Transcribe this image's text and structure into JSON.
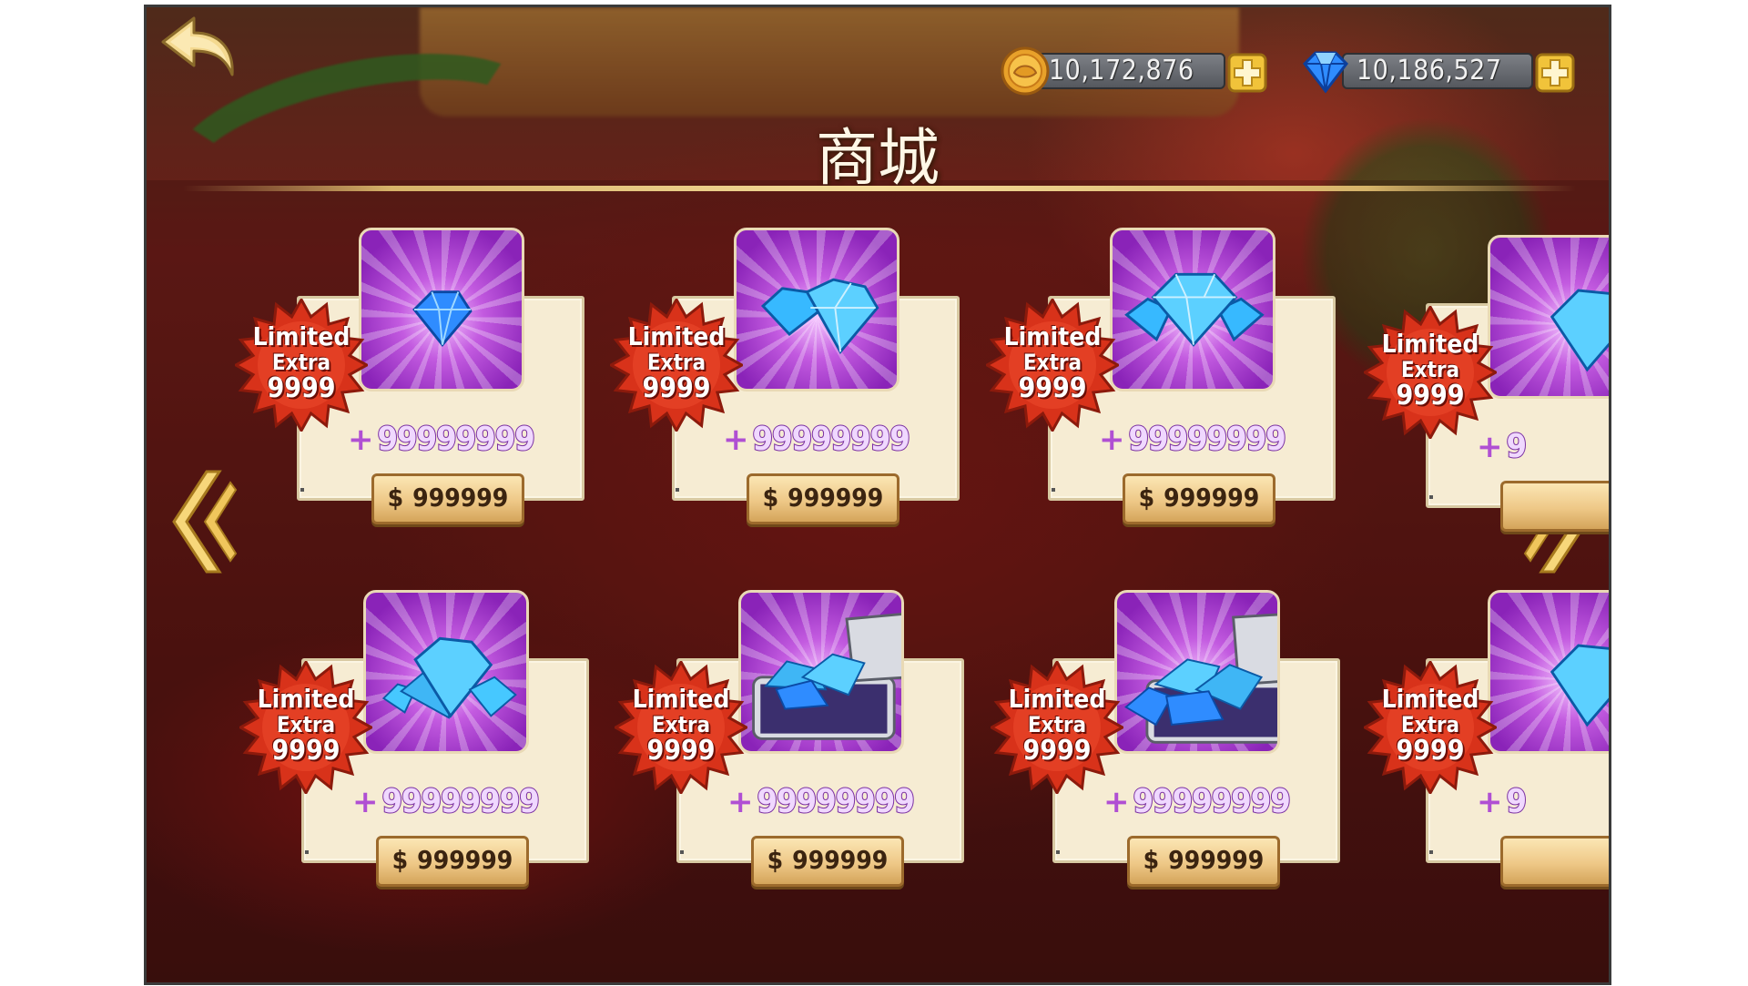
{
  "header": {
    "title": "商城",
    "coins": "10,172,876",
    "gems": "10,186,527"
  },
  "colors": {
    "accent_purple": "#b04fd3",
    "badge_red": "#d8321a",
    "panel": "#f6ecd3",
    "button_gold": "#eec887"
  },
  "icons": {
    "back": "back-arrow-icon",
    "coin": "coin-icon",
    "gem": "blue-gem-icon",
    "plus": "plus-icon",
    "prev": "chevron-left-icon",
    "next": "chevron-right-icon"
  },
  "items": [
    {
      "badge_line1": "Limited",
      "badge_line2": "Extra",
      "badge_line3": "9999",
      "plus": "+",
      "amount": "99999999",
      "currency": "$",
      "price": "999999",
      "art": "single-gem"
    },
    {
      "badge_line1": "Limited",
      "badge_line2": "Extra",
      "badge_line3": "9999",
      "plus": "+",
      "amount": "99999999",
      "currency": "$",
      "price": "999999",
      "art": "two-gems"
    },
    {
      "badge_line1": "Limited",
      "badge_line2": "Extra",
      "badge_line3": "9999",
      "plus": "+",
      "amount": "99999999",
      "currency": "$",
      "price": "999999",
      "art": "three-gems"
    },
    {
      "badge_line1": "Limited",
      "badge_line2": "Extra",
      "badge_line3": "9999",
      "plus": "+",
      "amount": "99999999",
      "currency": "$",
      "price": "999999",
      "art": "gem-pile"
    },
    {
      "badge_line1": "Limited",
      "badge_line2": "Extra",
      "badge_line3": "9999",
      "plus": "+",
      "amount": "99999999",
      "currency": "$",
      "price": "999999",
      "art": "gem-chest"
    },
    {
      "badge_line1": "Limited",
      "badge_line2": "Extra",
      "badge_line3": "9999",
      "plus": "+",
      "amount": "99999999",
      "currency": "$",
      "price": "999999",
      "art": "gem-chest-large"
    },
    {
      "badge_line1": "Limited",
      "badge_line2": "Extra",
      "badge_line3": "9999",
      "plus": "+",
      "amount": "9",
      "currency": "$",
      "price": "",
      "art": "partial"
    },
    {
      "badge_line1": "Limited",
      "badge_line2": "Extra",
      "badge_line3": "9999",
      "plus": "+",
      "amount": "9",
      "currency": "$",
      "price": "",
      "art": "partial"
    }
  ]
}
